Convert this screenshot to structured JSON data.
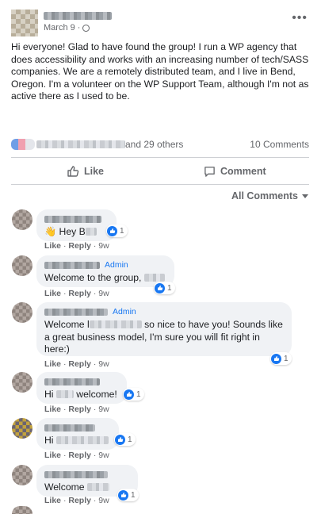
{
  "post": {
    "date": "March 9",
    "separator": "·",
    "body": "Hi everyone! Glad to have found the group! I run a WP agency that does accessibility and works with an increasing number of tech/SASS companies. We are a remotely distributed team, and I live in Bend, Oregon. I'm a volunteer on the WP Support Team, although I'm not as active there as I used to be.",
    "more_icon": "more-horizontal-icon"
  },
  "reactions": {
    "others_text": "and 29 others",
    "comments_count": "10 Comments"
  },
  "actions": {
    "like_label": "Like",
    "comment_label": "Comment"
  },
  "filter": {
    "label": "All Comments"
  },
  "comments": [
    {
      "prefix": "👋 Hey B",
      "suffix": "",
      "admin": "",
      "likes": "1",
      "like_label": "Like",
      "reply_label": "Reply",
      "time": "9w"
    },
    {
      "prefix": "Welcome to the group,",
      "suffix": "",
      "admin": "Admin",
      "likes": "1",
      "like_label": "Like",
      "reply_label": "Reply",
      "time": "9w"
    },
    {
      "prefix": "Welcome l",
      "suffix": "so nice to have you! Sounds like a great business model, I'm sure you will fit right in here:)",
      "admin": "Admin",
      "likes": "1",
      "like_label": "Like",
      "reply_label": "Reply",
      "time": "9w"
    },
    {
      "prefix": "Hi",
      "suffix": "welcome!",
      "admin": "",
      "likes": "1",
      "like_label": "Like",
      "reply_label": "Reply",
      "time": "9w"
    },
    {
      "prefix": "Hi",
      "suffix": "",
      "admin": "",
      "likes": "1",
      "like_label": "Like",
      "reply_label": "Reply",
      "time": "9w"
    },
    {
      "prefix": "Welcome",
      "suffix": "",
      "admin": "",
      "likes": "1",
      "like_label": "Like",
      "reply_label": "Reply",
      "time": "9w"
    }
  ],
  "separator": "·",
  "colors": {
    "accent": "#1877f2",
    "bubble": "#f0f2f5",
    "muted": "#65676b"
  }
}
